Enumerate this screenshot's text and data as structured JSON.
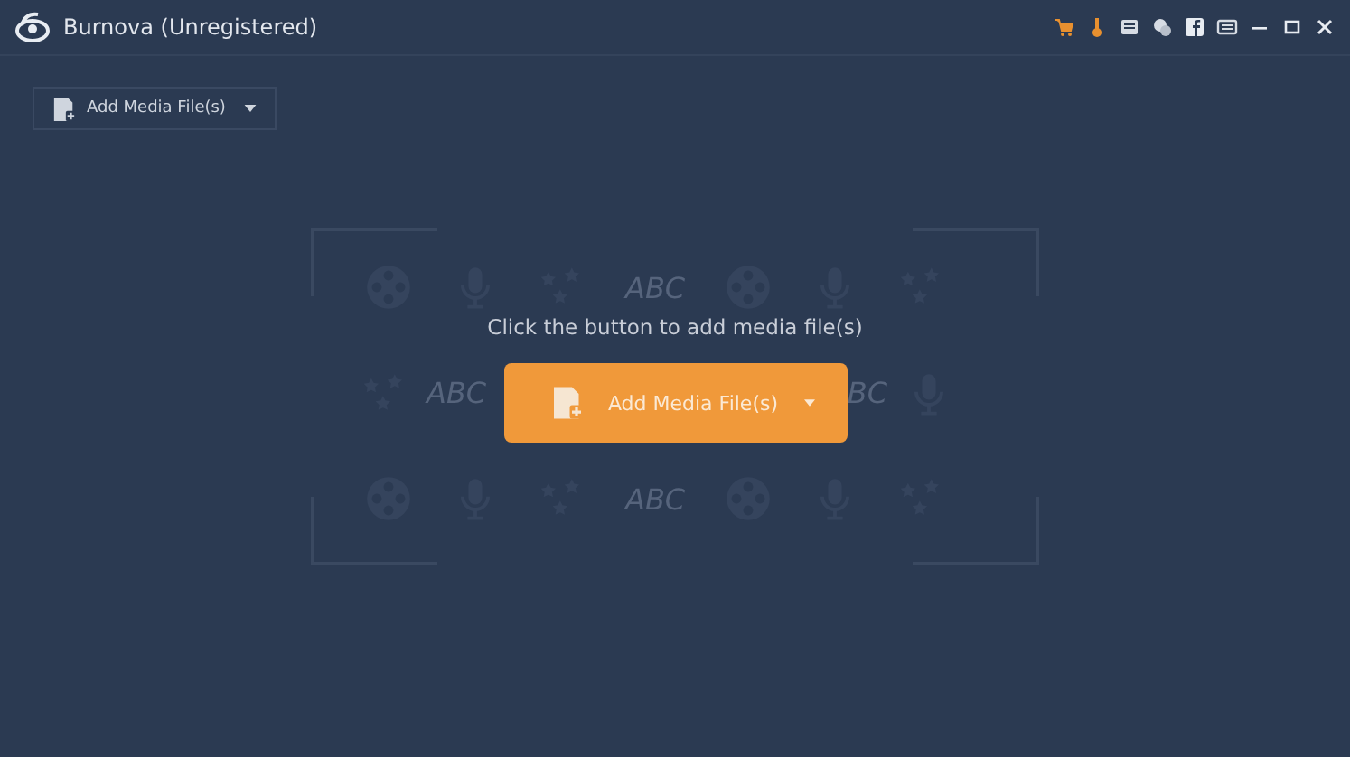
{
  "window": {
    "title": "Burnova (Unregistered)"
  },
  "toolbar": {
    "add_button": {
      "label": "Add Media File(s)"
    }
  },
  "drop_zone": {
    "prompt": "Click the button to add media file(s)",
    "button": {
      "label": "Add Media File(s)"
    },
    "pattern": [
      {
        "left": [
          {
            "kind": "film"
          },
          {
            "kind": "mic"
          },
          {
            "kind": "stars"
          },
          {
            "kind": "text",
            "text": "ABC"
          },
          {
            "kind": "film"
          },
          {
            "kind": "mic"
          },
          {
            "kind": "stars"
          }
        ]
      },
      {
        "left": [
          {
            "kind": "stars"
          },
          {
            "kind": "text",
            "text": "ABC"
          }
        ],
        "right": [
          {
            "kind": "text",
            "text": "BC"
          },
          {
            "kind": "mic"
          }
        ]
      },
      {
        "left": [
          {
            "kind": "film"
          },
          {
            "kind": "mic"
          },
          {
            "kind": "stars"
          },
          {
            "kind": "text",
            "text": "ABC"
          },
          {
            "kind": "film"
          },
          {
            "kind": "mic"
          },
          {
            "kind": "stars"
          }
        ]
      }
    ]
  }
}
